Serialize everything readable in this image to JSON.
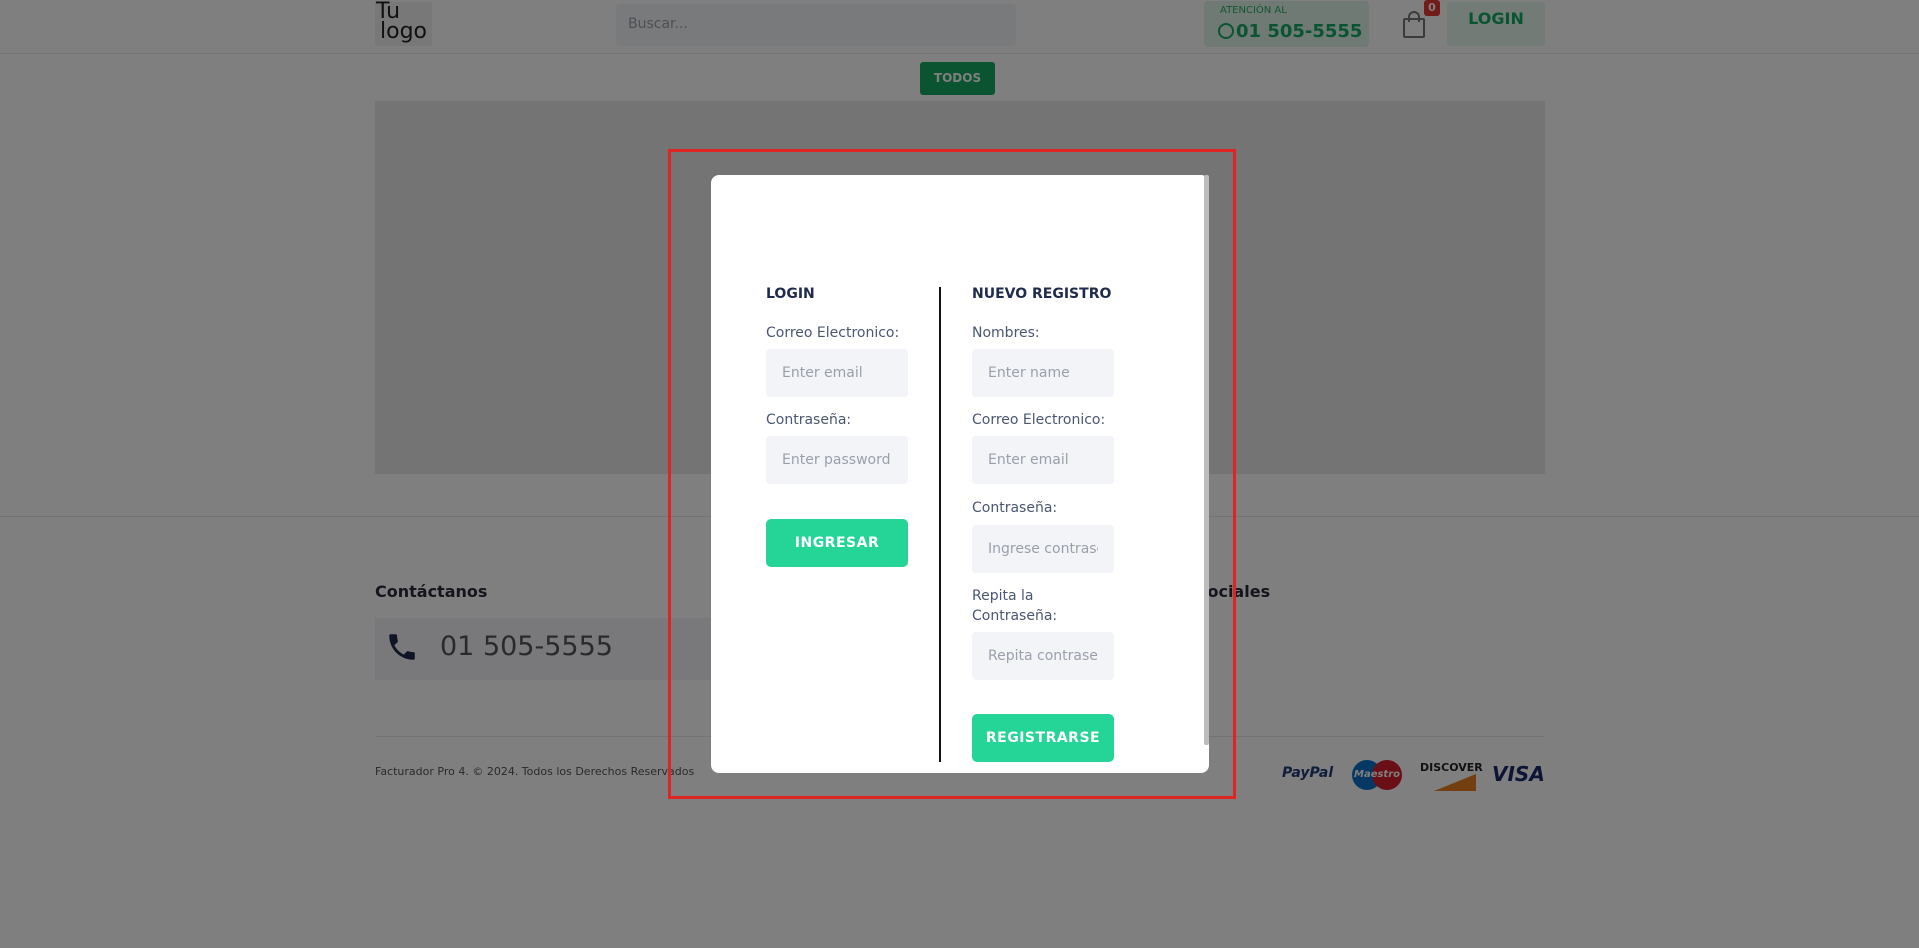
{
  "header": {
    "logo_line1": "Tu",
    "logo_line2": "logo",
    "search_placeholder": "Buscar...",
    "attention_label": "ATENCIÓN AL",
    "attention_phone": "01 505-5555",
    "cart_count": "0",
    "login_label": "LOGIN"
  },
  "nav": {
    "todos_label": "TODOS"
  },
  "footer": {
    "contact_title": "Contáctanos",
    "contact_phone": "01 505-5555",
    "social_title": "es Sociales",
    "copyright": "Facturador Pro 4. © 2024. Todos los Derechos Reservados",
    "payments": {
      "paypal": "PayPal",
      "maestro": "Maestro",
      "discover": "DISCOVER",
      "visa": "VISA"
    }
  },
  "modal": {
    "login": {
      "title": "LOGIN",
      "email_label": "Correo Electronico:",
      "email_placeholder": "Enter email",
      "password_label": "Contraseña:",
      "password_placeholder": "Enter password",
      "submit_label": "INGRESAR"
    },
    "register": {
      "title": "NUEVO REGISTRO",
      "name_label": "Nombres:",
      "name_placeholder": "Enter name",
      "email_label": "Correo Electronico:",
      "email_placeholder": "Enter email",
      "password_label": "Contraseña:",
      "password_placeholder": "Ingrese contraseña",
      "repeat_label": "Repita la Contraseña:",
      "repeat_placeholder": "Repita contraseña",
      "submit_label": "REGISTRARSE"
    }
  },
  "colors": {
    "accent": "#25d497",
    "brand_green": "#16a864",
    "highlight": "#e02424",
    "badge": "#e53935"
  },
  "icons": [
    "whatsapp-icon",
    "cart-icon",
    "phone-icon"
  ]
}
